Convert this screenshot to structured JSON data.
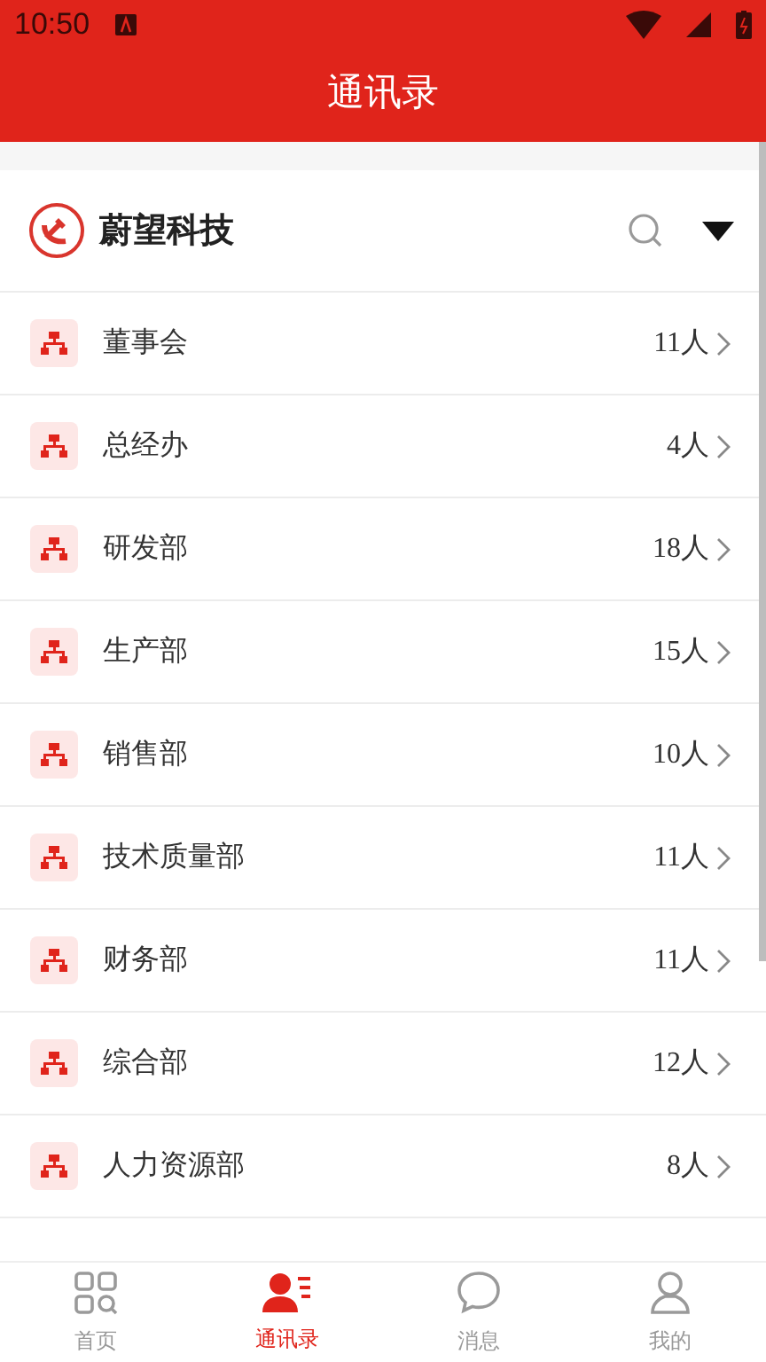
{
  "status_bar": {
    "time": "10:50"
  },
  "header": {
    "title": "通讯录"
  },
  "organization": {
    "name": "蔚望科技"
  },
  "departments": [
    {
      "name": "董事会",
      "count": "11人"
    },
    {
      "name": "总经办",
      "count": "4人"
    },
    {
      "name": "研发部",
      "count": "18人"
    },
    {
      "name": "生产部",
      "count": "15人"
    },
    {
      "name": "销售部",
      "count": "10人"
    },
    {
      "name": "技术质量部",
      "count": "11人"
    },
    {
      "name": "财务部",
      "count": "11人"
    },
    {
      "name": "综合部",
      "count": "12人"
    },
    {
      "name": "人力资源部",
      "count": "8人"
    }
  ],
  "tab_bar": [
    {
      "kind": "home",
      "label": "首页",
      "selected": false
    },
    {
      "kind": "contacts",
      "label": "通讯录",
      "selected": true
    },
    {
      "kind": "messages",
      "label": "消息",
      "selected": false
    },
    {
      "kind": "profile",
      "label": "我的",
      "selected": false
    }
  ]
}
